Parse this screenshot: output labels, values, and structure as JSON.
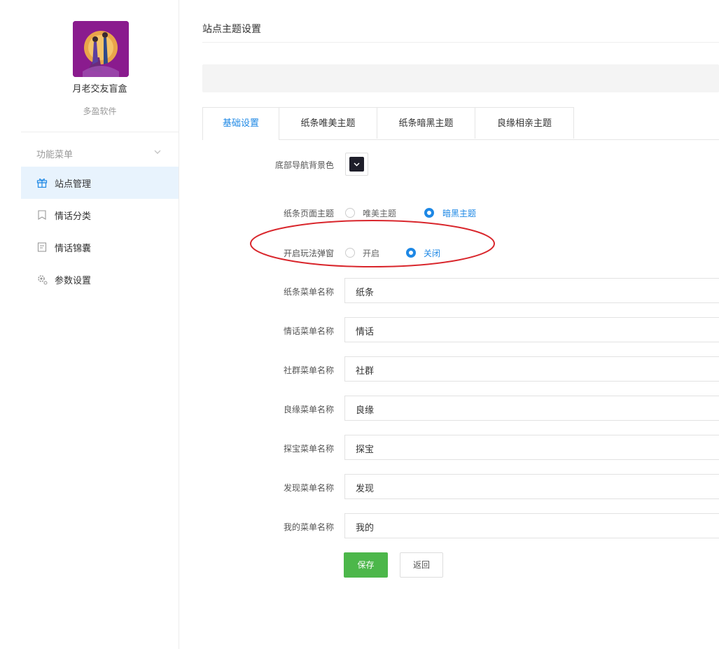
{
  "app": {
    "name": "月老交友盲盒",
    "company": "多盈软件"
  },
  "menu": {
    "heading": "功能菜单",
    "items": [
      {
        "label": "站点管理",
        "icon": "gift-icon",
        "active": true
      },
      {
        "label": "情话分类",
        "icon": "bookmark-icon",
        "active": false
      },
      {
        "label": "情话锦囊",
        "icon": "document-icon",
        "active": false
      },
      {
        "label": "参数设置",
        "icon": "gear-icon",
        "active": false
      }
    ]
  },
  "page": {
    "title": "站点主题设置"
  },
  "tabs": [
    {
      "label": "基础设置",
      "active": true
    },
    {
      "label": "纸条唯美主题",
      "active": false
    },
    {
      "label": "纸条暗黑主题",
      "active": false
    },
    {
      "label": "良缘相亲主题",
      "active": false
    }
  ],
  "form": {
    "nav_bg": {
      "label": "底部导航背景色",
      "color": "#1e1e2a"
    },
    "paper_theme": {
      "label": "纸条页面主题",
      "options": [
        {
          "label": "唯美主题",
          "checked": false
        },
        {
          "label": "暗黑主题",
          "checked": true
        }
      ]
    },
    "popup": {
      "label": "开启玩法弹窗",
      "options": [
        {
          "label": "开启",
          "checked": false
        },
        {
          "label": "关闭",
          "checked": true
        }
      ]
    },
    "fields": [
      {
        "label": "纸条菜单名称",
        "value": "纸条"
      },
      {
        "label": "情话菜单名称",
        "value": "情话"
      },
      {
        "label": "社群菜单名称",
        "value": "社群"
      },
      {
        "label": "良缘菜单名称",
        "value": "良缘"
      },
      {
        "label": "探宝菜单名称",
        "value": "探宝"
      },
      {
        "label": "发现菜单名称",
        "value": "发现"
      },
      {
        "label": "我的菜单名称",
        "value": "我的"
      }
    ]
  },
  "buttons": {
    "save": "保存",
    "back": "返回"
  },
  "colors": {
    "accent": "#1e88e5",
    "save": "#4cb74a",
    "annotation": "#d9262c"
  }
}
